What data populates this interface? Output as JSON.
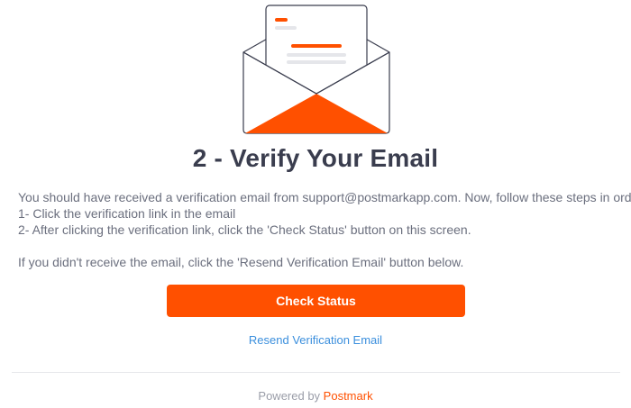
{
  "illustration": {
    "icon": "open-envelope-icon",
    "accent_color": "#ff5000",
    "line_color": "#3a3d4e",
    "placeholder_color": "#e5e6ea"
  },
  "title": "2 - Verify Your Email",
  "instructions": {
    "line1": "You should have received a verification email from support@postmarkapp.com. Now, follow these steps in order;",
    "step1": "1- Click the verification link in the email",
    "step2": "2- After clicking the verification link, click the 'Check Status' button on this screen.",
    "resend_note": "If you didn't receive the email, click the 'Resend Verification Email' button below."
  },
  "actions": {
    "check_status_label": "Check Status",
    "resend_label": "Resend Verification Email"
  },
  "footer": {
    "powered_by": "Powered by",
    "brand": "Postmark"
  },
  "colors": {
    "primary": "#ff5000",
    "link": "#3b8fdd",
    "title": "#3a3d4e",
    "body_text": "#6b6f7e",
    "footer_text": "#9a9da8"
  }
}
